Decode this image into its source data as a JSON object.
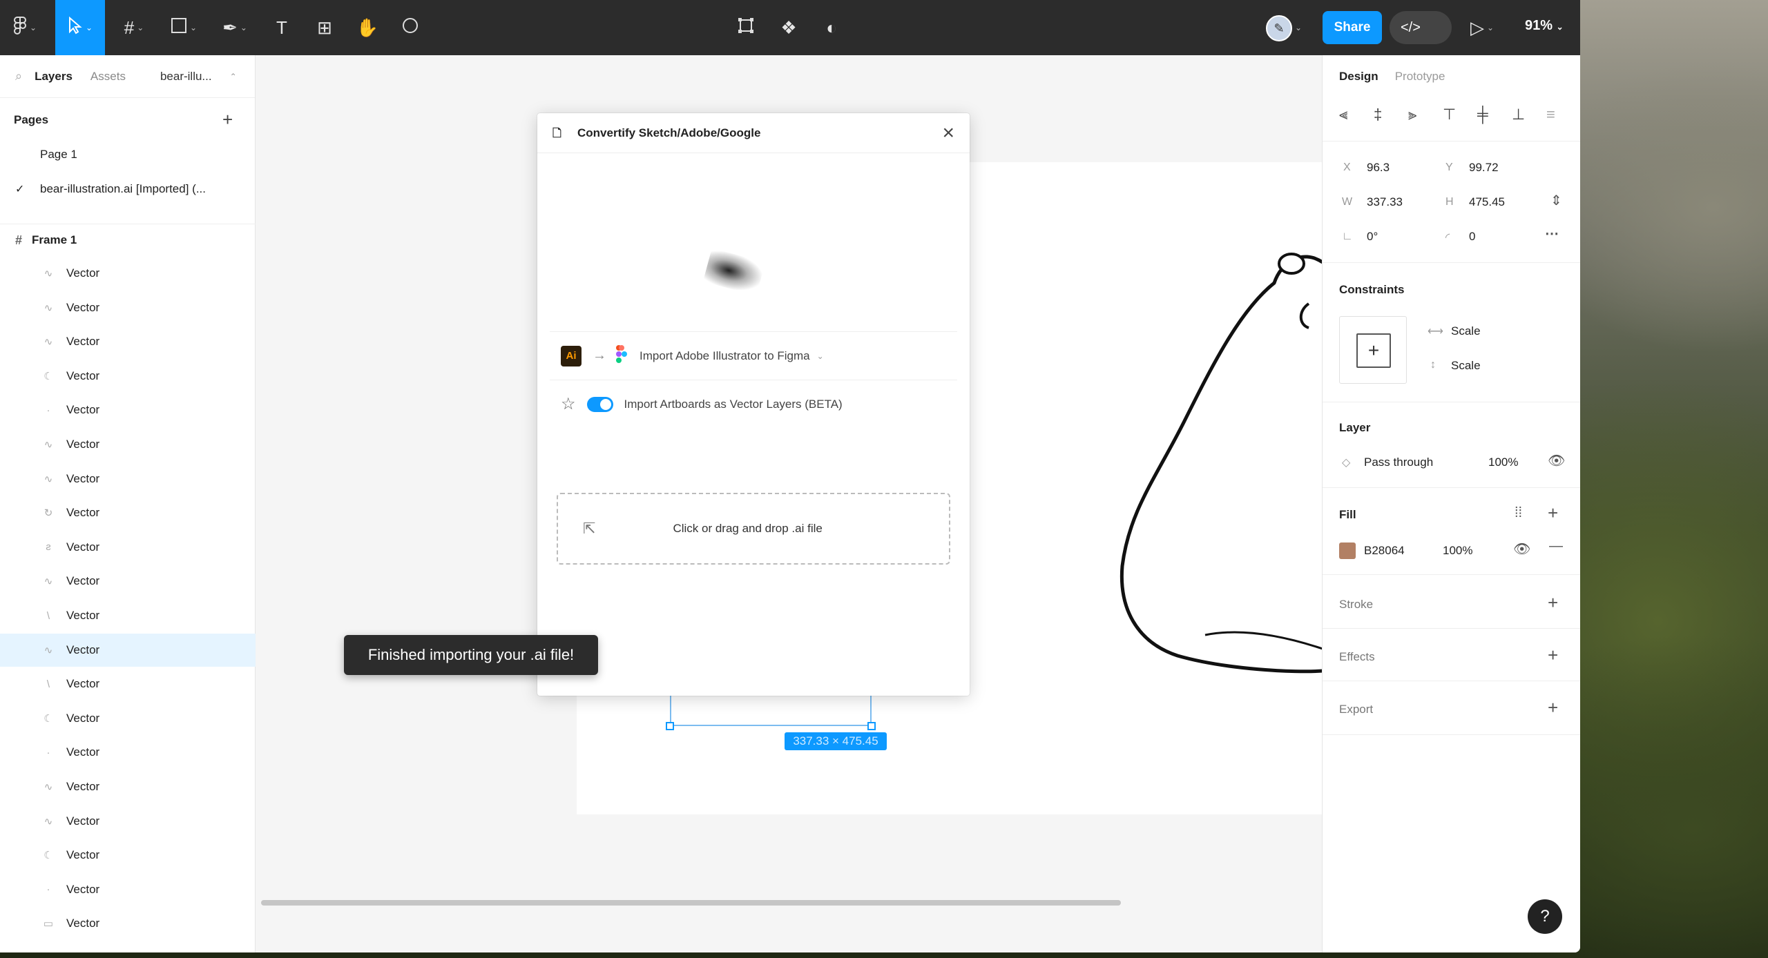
{
  "toolbar": {
    "zoom": "91%",
    "share_label": "Share",
    "dev_mode_icon": "</>"
  },
  "left_panel": {
    "tabs": [
      "Layers",
      "Assets",
      "bear-illu..."
    ],
    "pages_title": "Pages",
    "pages": [
      "Page 1",
      "bear-illustration.ai [Imported] (..."
    ],
    "frame_name": "Frame 1",
    "layers": [
      "Vector",
      "Vector",
      "Vector",
      "Vector",
      "Vector",
      "Vector",
      "Vector",
      "Vector",
      "Vector",
      "Vector",
      "Vector",
      "Vector",
      "Vector",
      "Vector",
      "Vector",
      "Vector",
      "Vector",
      "Vector",
      "Vector",
      "Vector"
    ]
  },
  "plugin": {
    "title": "Convertify Sketch/Adobe/Google",
    "import_option": "Import Adobe Illustrator to Figma",
    "artboards_option": "Import Artboards as Vector Layers (BETA)",
    "dropzone_text": "Click or drag and drop .ai file",
    "ai_badge": "Ai"
  },
  "canvas": {
    "toast": "Finished importing your .ai file!",
    "dimensions": "337.33 × 475.45"
  },
  "right_panel": {
    "tabs": [
      "Design",
      "Prototype"
    ],
    "x_label": "X",
    "x": "96.3",
    "y_label": "Y",
    "y": "99.72",
    "w_label": "W",
    "w": "337.33",
    "h_label": "H",
    "h": "475.45",
    "rotation": "0°",
    "radius": "0",
    "constraints_title": "Constraints",
    "constraint_h": "Scale",
    "constraint_v": "Scale",
    "layer_title": "Layer",
    "blend_mode": "Pass through",
    "layer_opacity": "100%",
    "fill_title": "Fill",
    "fill_hex": "B28064",
    "fill_opacity": "100%",
    "fill_color": "#b28064",
    "stroke_title": "Stroke",
    "effects_title": "Effects",
    "export_title": "Export"
  },
  "help": "?"
}
